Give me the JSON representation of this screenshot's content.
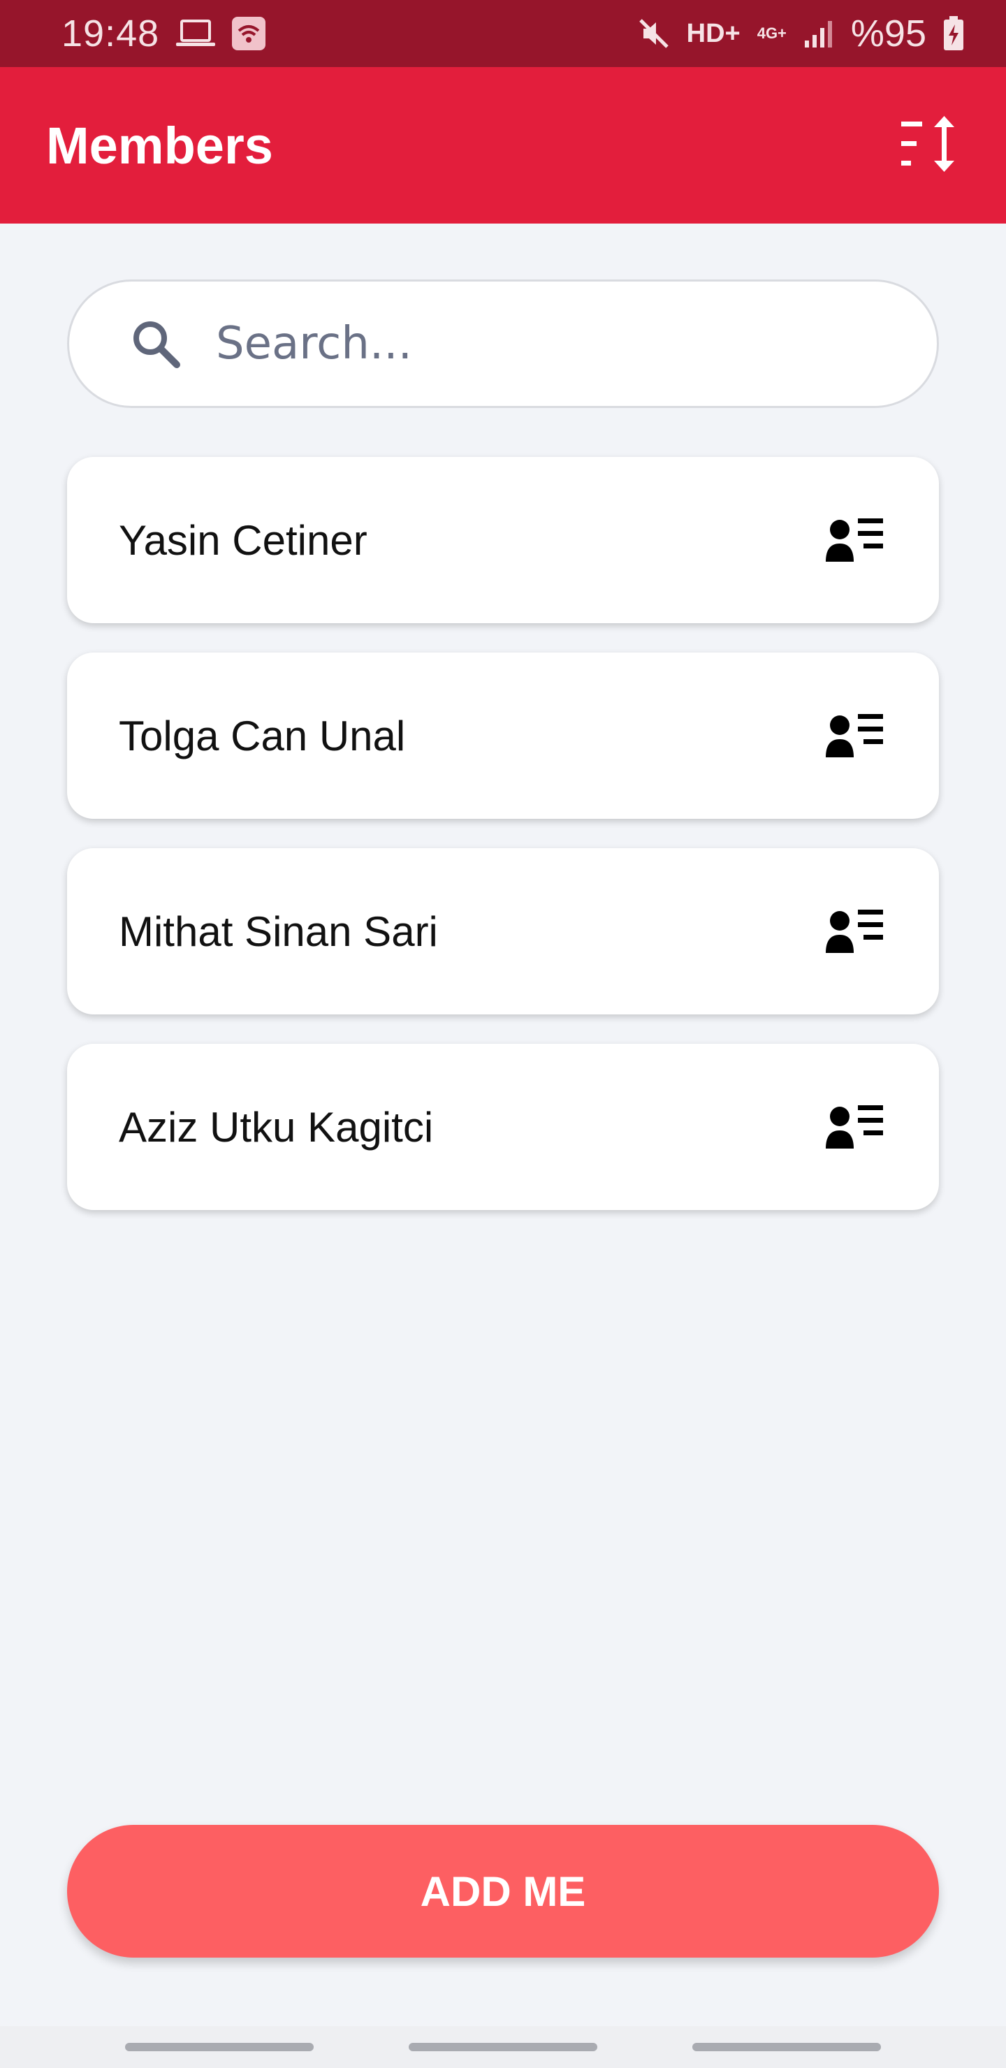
{
  "status_bar": {
    "time": "19:48",
    "network": "HD+",
    "signal_type": "4G+",
    "battery": "%95",
    "icons": [
      "laptop-icon",
      "wifi-hotspot-icon",
      "mute-icon",
      "signal-icon",
      "battery-charging-icon"
    ]
  },
  "app_bar": {
    "title": "Members",
    "sort_icon": "sort-icon"
  },
  "search": {
    "placeholder": "Search...",
    "value": ""
  },
  "members": [
    {
      "name": "Yasin Cetiner",
      "icon": "contact-details-icon"
    },
    {
      "name": "Tolga Can Unal",
      "icon": "contact-details-icon"
    },
    {
      "name": "Mithat Sinan Sari",
      "icon": "contact-details-icon"
    },
    {
      "name": "Aziz Utku Kagitci",
      "icon": "contact-details-icon"
    }
  ],
  "add_button": {
    "label": "ADD ME"
  },
  "colors": {
    "status_bar": "#96152b",
    "app_bar": "#e31e3c",
    "background": "#f2f4f8",
    "add_button": "#fd5f62"
  }
}
